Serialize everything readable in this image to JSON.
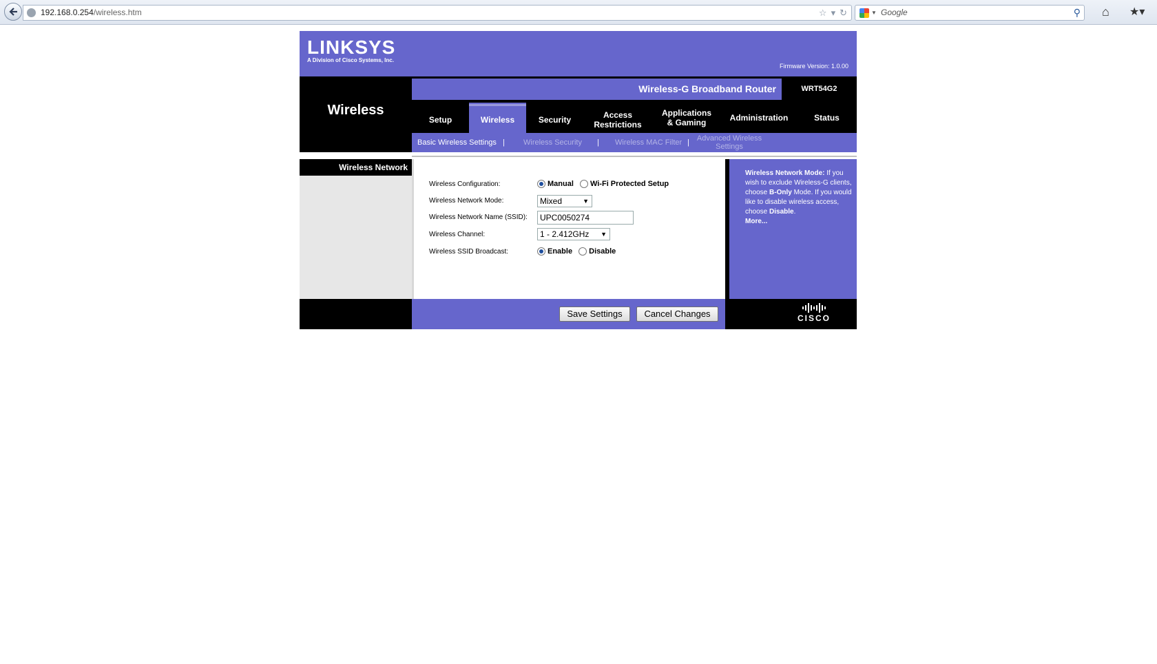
{
  "browser": {
    "url_host": "192.168.0.254",
    "url_path": "/wireless.htm",
    "search_placeholder": "Google"
  },
  "header": {
    "logo": "LINKSYS",
    "logo_sub": "A Division of Cisco Systems, Inc.",
    "firmware": "Firmware Version: 1.0.00",
    "product_name": "Wireless-G Broadband Router",
    "model": "WRT54G2",
    "section_title": "Wireless"
  },
  "tabs": [
    {
      "label": "Setup"
    },
    {
      "label": "Wireless",
      "active": true
    },
    {
      "label": "Security"
    },
    {
      "label": "Access Restrictions"
    },
    {
      "label": "Applications & Gaming"
    },
    {
      "label": "Administration"
    },
    {
      "label": "Status"
    }
  ],
  "subnav": [
    {
      "label": "Basic Wireless Settings",
      "active": true
    },
    {
      "label": "Wireless Security"
    },
    {
      "label": "Wireless MAC Filter"
    },
    {
      "label": "Advanced Wireless Settings"
    }
  ],
  "left_heading": "Wireless Network",
  "form": {
    "config_label": "Wireless Configuration:",
    "config_options": [
      "Manual",
      "Wi-Fi Protected Setup"
    ],
    "config_selected": "Manual",
    "mode_label": "Wireless Network Mode:",
    "mode_value": "Mixed",
    "ssid_label": "Wireless Network Name (SSID):",
    "ssid_value": "UPC0050274",
    "channel_label": "Wireless Channel:",
    "channel_value": "1 - 2.412GHz",
    "broadcast_label": "Wireless SSID Broadcast:",
    "broadcast_options": [
      "Enable",
      "Disable"
    ],
    "broadcast_selected": "Enable"
  },
  "help": {
    "title": "Wireless Network Mode:",
    "body_1": " If you wish to exclude Wireless-G clients, choose ",
    "bold_1": "B-Only",
    "body_2": " Mode. If you would like to disable wireless access, choose ",
    "bold_2": "Disable",
    "body_3": ".",
    "more": "More..."
  },
  "buttons": {
    "save": "Save Settings",
    "cancel": "Cancel Changes"
  },
  "footer": {
    "brand": "CISCO"
  },
  "colors": {
    "accent": "#6666cc",
    "dark": "#000000"
  }
}
